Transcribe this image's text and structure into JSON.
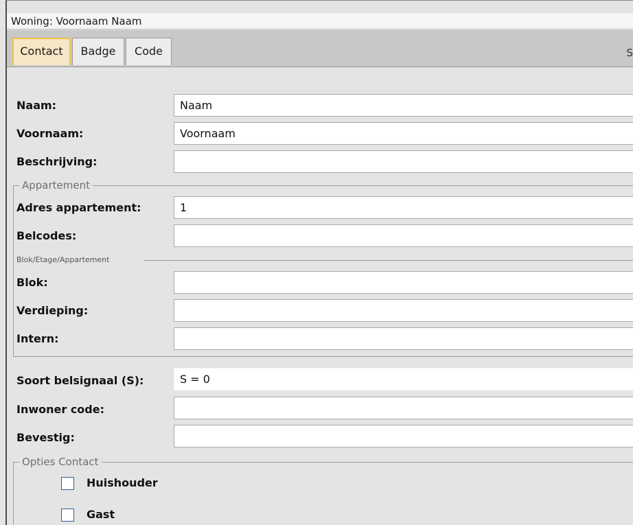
{
  "window": {
    "title": "Woning: Voornaam Naam"
  },
  "tabs": [
    {
      "label": "Contact"
    },
    {
      "label": "Badge"
    },
    {
      "label": "Code"
    }
  ],
  "tabbar_extra": "S",
  "fields": {
    "naam": {
      "label": "Naam:",
      "value": "Naam"
    },
    "voornaam": {
      "label": "Voornaam:",
      "value": "Voornaam"
    },
    "beschrijving": {
      "label": "Beschrijving:",
      "value": ""
    }
  },
  "appartement": {
    "title": "Appartement",
    "adres": {
      "label": "Adres appartement:",
      "value": "1"
    },
    "belcodes": {
      "label": "Belcodes:",
      "value": ""
    },
    "sub": {
      "title": "Blok/Etage/Appartement",
      "blok": {
        "label": "Blok:",
        "value": ""
      },
      "verdieping": {
        "label": "Verdieping:",
        "value": ""
      },
      "intern": {
        "label": "Intern:",
        "value": ""
      }
    }
  },
  "soort": {
    "label": "Soort belsignaal (S):",
    "value": "S = 0"
  },
  "inwoner": {
    "label": "Inwoner code:",
    "value": ""
  },
  "bevestig": {
    "label": "Bevestig:",
    "value": ""
  },
  "opties": {
    "title": "Opties Contact",
    "items": [
      {
        "label": "Huishouder",
        "checked": false
      },
      {
        "label": "Gast",
        "checked": false
      }
    ]
  }
}
